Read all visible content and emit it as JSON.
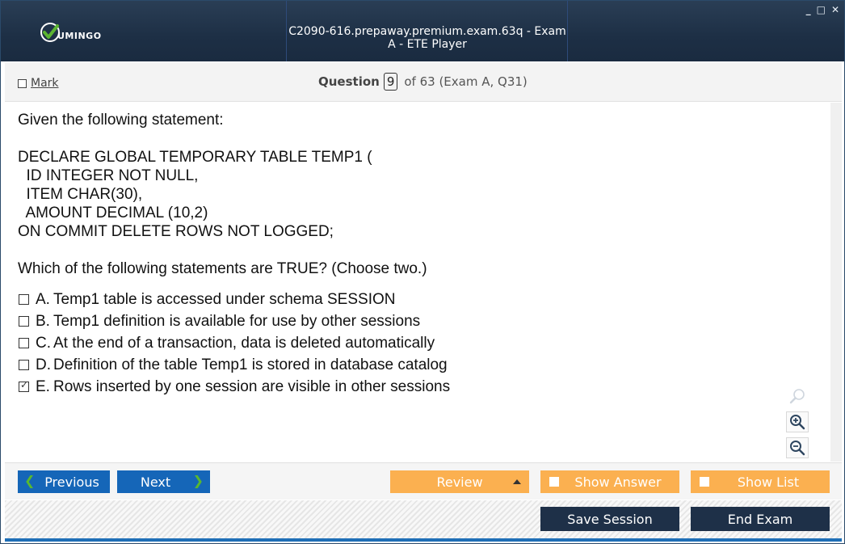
{
  "window": {
    "title": "C2090-616.prepaway.premium.exam.63q - Exam A - ETE Player",
    "logo_text": "UMINGO",
    "controls": [
      "_",
      "□",
      "✕"
    ]
  },
  "header": {
    "mark_label": "Mark",
    "question_label": "Question",
    "question_number": "9",
    "question_of": "of 63 (Exam A, Q31)"
  },
  "question": {
    "intro": "Given the following statement:",
    "code_lines": [
      "DECLARE GLOBAL TEMPORARY TABLE TEMP1 (",
      "  ID INTEGER NOT NULL,",
      "  ITEM CHAR(30),",
      "  AMOUNT DECIMAL (10,2)",
      "ON COMMIT DELETE ROWS NOT LOGGED;"
    ],
    "prompt": "Which of the following statements are TRUE? (Choose two.)",
    "options": [
      {
        "letter": "A.",
        "text": "Temp1 table is accessed under schema SESSION",
        "checked": false
      },
      {
        "letter": "B.",
        "text": "Temp1 definition is available for use by other sessions",
        "checked": false
      },
      {
        "letter": "C.",
        "text": "At the end of a transaction, data is deleted automatically",
        "checked": false
      },
      {
        "letter": "D.",
        "text": "Definition of the table Temp1 is stored in database catalog",
        "checked": false
      },
      {
        "letter": "E.",
        "text": "Rows inserted by one session are visible in other sessions",
        "checked": true
      }
    ]
  },
  "zoom": {
    "icons": [
      "search-icon",
      "zoom-in-icon",
      "zoom-out-icon"
    ]
  },
  "nav": {
    "previous_label": "Previous",
    "next_label": "Next",
    "review_label": "Review",
    "show_answer_label": "Show Answer",
    "show_list_label": "Show List"
  },
  "footer": {
    "save_label": "Save Session",
    "end_label": "End Exam"
  },
  "colors": {
    "titlebar": "#1d2f45",
    "blue_button": "#1566b8",
    "orange_button": "#fbb050",
    "dark_button": "#1e3048",
    "logo_green": "#5cb531"
  }
}
